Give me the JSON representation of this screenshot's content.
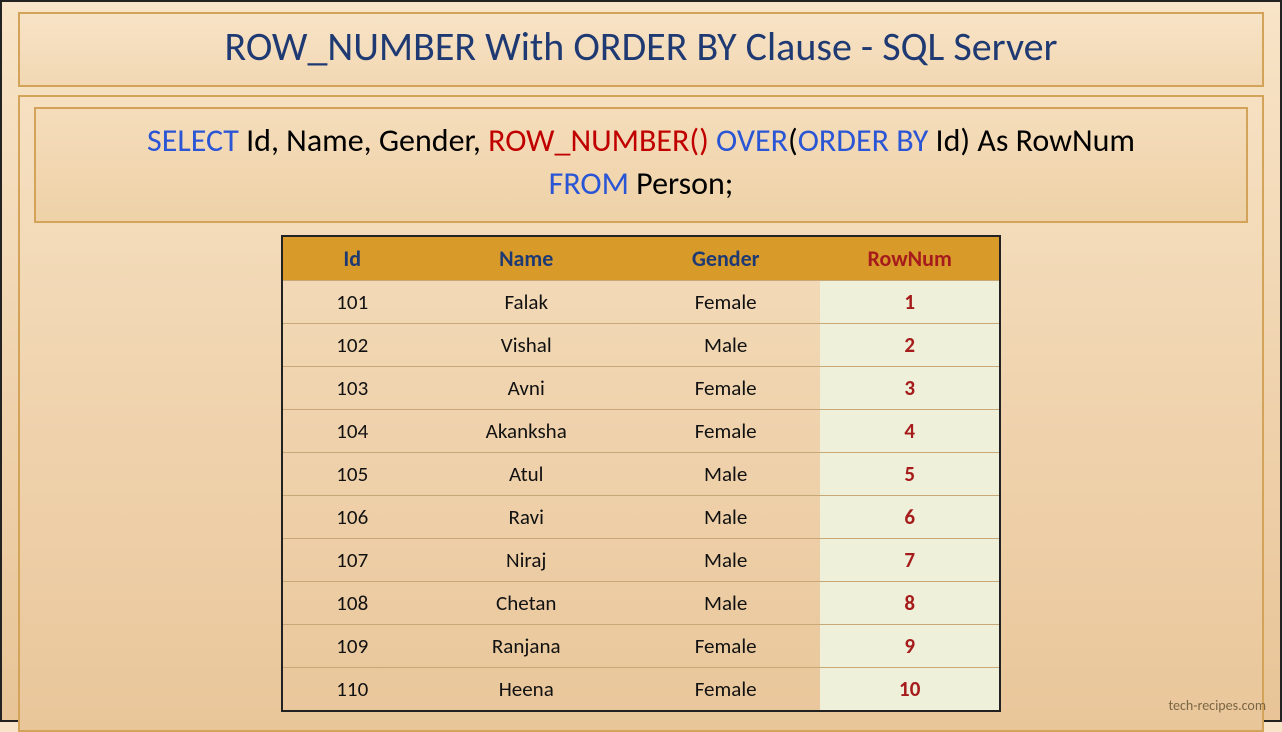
{
  "title": "ROW_NUMBER With ORDER BY Clause - SQL Server",
  "sql": {
    "select": "SELECT",
    "cols": " Id, Name, Gender, ",
    "rownum": "ROW_NUMBER()",
    "space1": " ",
    "over": "OVER",
    "paren_open": "(",
    "orderby": "ORDER BY",
    "ob_col": " Id)",
    "as_alias": " As RowNum",
    "from": "FROM",
    "table": " Person;"
  },
  "headers": {
    "id": "Id",
    "name": "Name",
    "gender": "Gender",
    "rownum": "RowNum"
  },
  "rows": [
    {
      "id": "101",
      "name": "Falak",
      "gender": "Female",
      "rownum": "1"
    },
    {
      "id": "102",
      "name": "Vishal",
      "gender": "Male",
      "rownum": "2"
    },
    {
      "id": "103",
      "name": "Avni",
      "gender": "Female",
      "rownum": "3"
    },
    {
      "id": "104",
      "name": "Akanksha",
      "gender": "Female",
      "rownum": "4"
    },
    {
      "id": "105",
      "name": "Atul",
      "gender": "Male",
      "rownum": "5"
    },
    {
      "id": "106",
      "name": "Ravi",
      "gender": "Male",
      "rownum": "6"
    },
    {
      "id": "107",
      "name": "Niraj",
      "gender": "Male",
      "rownum": "7"
    },
    {
      "id": "108",
      "name": "Chetan",
      "gender": "Male",
      "rownum": "8"
    },
    {
      "id": "109",
      "name": "Ranjana",
      "gender": "Female",
      "rownum": "9"
    },
    {
      "id": "110",
      "name": "Heena",
      "gender": "Female",
      "rownum": "10"
    }
  ],
  "watermark": "tech-recipes.com"
}
